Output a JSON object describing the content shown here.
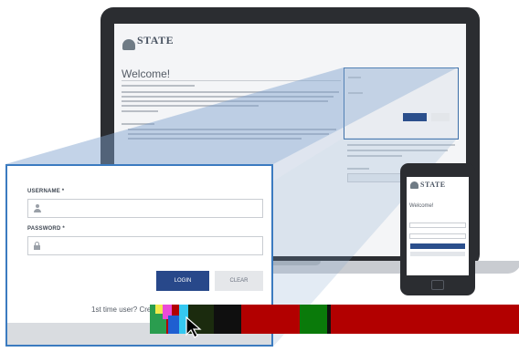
{
  "laptop_screen": {
    "brand": "STATE",
    "welcome": "Welcome!"
  },
  "phone_screen": {
    "brand": "STATE",
    "welcome": "Welcome!"
  },
  "login_form": {
    "username_label": "USERNAME *",
    "password_label": "PASSWORD *",
    "login_button": "LOGIN",
    "clear_button": "CLEAR",
    "signup_prompt": "1st time user? Create"
  },
  "icons": {
    "user": "user-icon",
    "lock": "lock-icon",
    "cursor": "mouse-cursor-icon"
  },
  "colors": {
    "brand_blue": "#28488a",
    "highlight_border": "#3b7bc0",
    "device_frame": "#2b2d31",
    "glitch_red": "#b20000",
    "glitch_green": "#0a7a0a"
  }
}
